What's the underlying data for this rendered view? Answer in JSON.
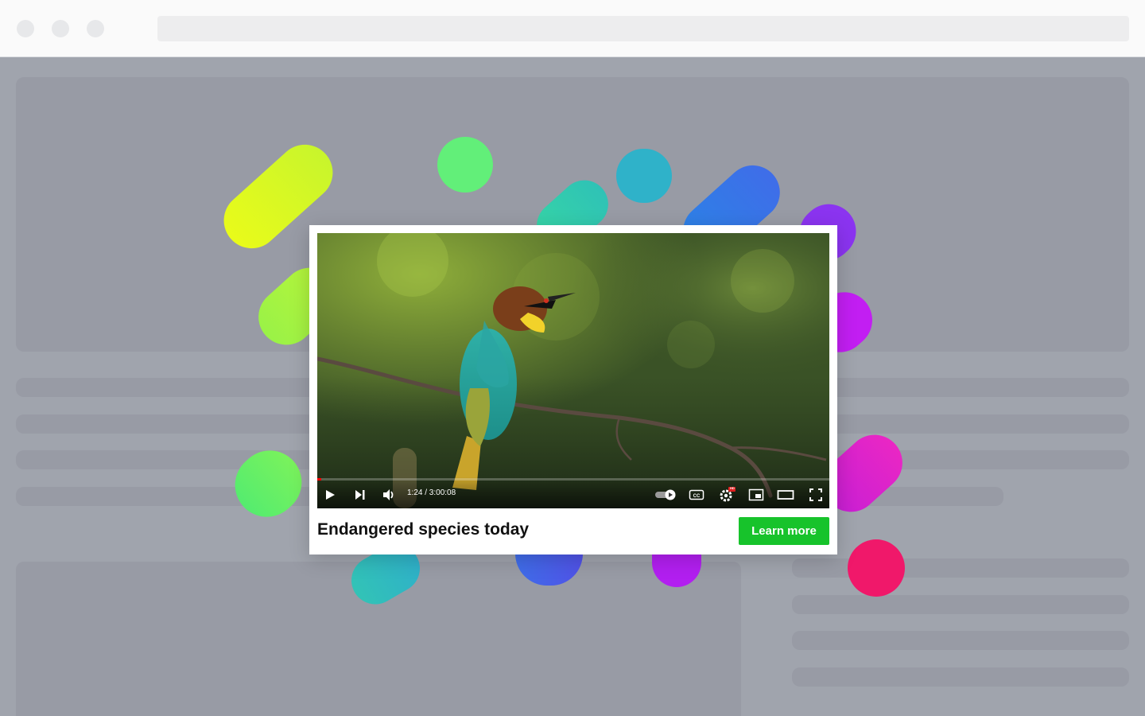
{
  "browser": {
    "traffic_lights": [
      "close",
      "minimize",
      "maximize"
    ]
  },
  "video": {
    "current_time": "1:24",
    "duration": "3:00:08",
    "time_display": "1:24 / 3:00:08",
    "progress_fraction": 0.0078,
    "settings_badge": "HD",
    "controls": [
      "play-icon",
      "next-icon",
      "volume-icon",
      "autoplay-toggle-icon",
      "captions-icon",
      "settings-icon",
      "miniplayer-icon",
      "theater-mode-icon",
      "fullscreen-icon"
    ]
  },
  "card": {
    "title": "Endangered species today",
    "cta_label": "Learn more"
  },
  "colors": {
    "cta": "#17c32b",
    "progress": "#ff0000",
    "pill_gradient": [
      "#e9fb1a",
      "#9af247",
      "#42e07a",
      "#2fb8c9",
      "#3f6de8",
      "#9d2ff0",
      "#e12bd1",
      "#f0185f"
    ]
  }
}
